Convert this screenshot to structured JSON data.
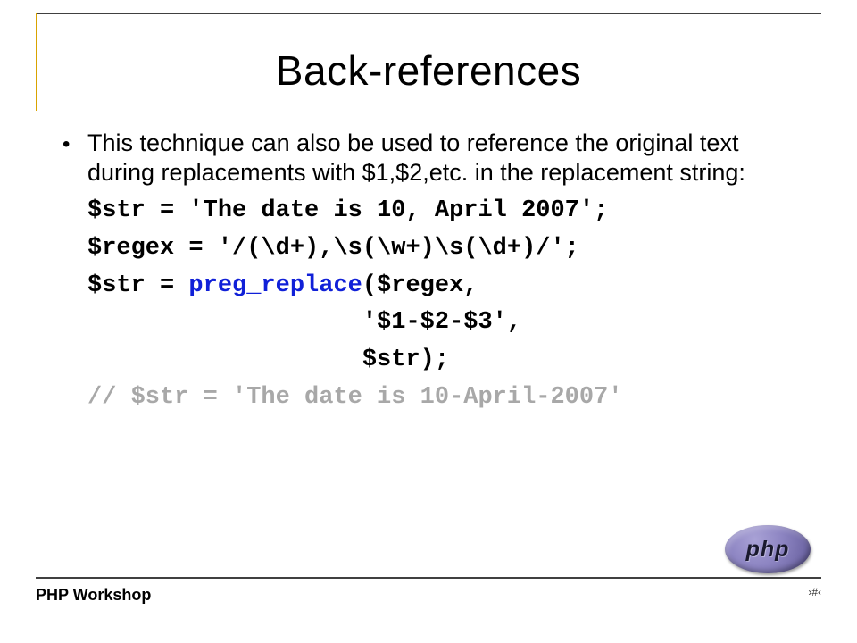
{
  "title": "Back-references",
  "bullet": {
    "text": "This technique can also be used to reference the original text during replacements with $1,$2,etc. in the replacement string:"
  },
  "code": {
    "l1": "$str = 'The date is 10, April 2007';",
    "l2": "$regex = '/(\\d+),\\s(\\w+)\\s(\\d+)/';",
    "l3a": "$str = ",
    "l3b": "preg_replace",
    "l3c": "($regex,",
    "l4": "                   '$1-$2-$3',",
    "l5": "                   $str);",
    "l6": "// $str = 'The date is 10-April-2007'"
  },
  "footer": {
    "workshop": "PHP Workshop",
    "page": "›#‹"
  },
  "logo": {
    "text": "php"
  }
}
